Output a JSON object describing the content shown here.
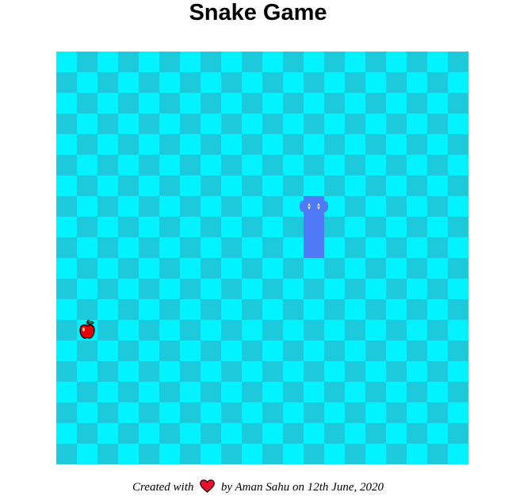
{
  "title": "Snake Game",
  "board": {
    "cols": 20,
    "rows": 20,
    "color_light": "#00f2ff",
    "color_dark": "#1ccadb"
  },
  "snake": {
    "color": "#5079f7",
    "direction": "up",
    "segments": [
      {
        "col": 12,
        "row": 7
      },
      {
        "col": 12,
        "row": 8
      },
      {
        "col": 12,
        "row": 9
      }
    ]
  },
  "apple": {
    "col": 1,
    "row": 13,
    "icon": "apple-icon",
    "color": "#e60000"
  },
  "footer": {
    "prefix": "Created with",
    "icon": "heart-icon",
    "heart_color": "#e8102a",
    "suffix": "by Aman Sahu on 12th June, 2020"
  }
}
